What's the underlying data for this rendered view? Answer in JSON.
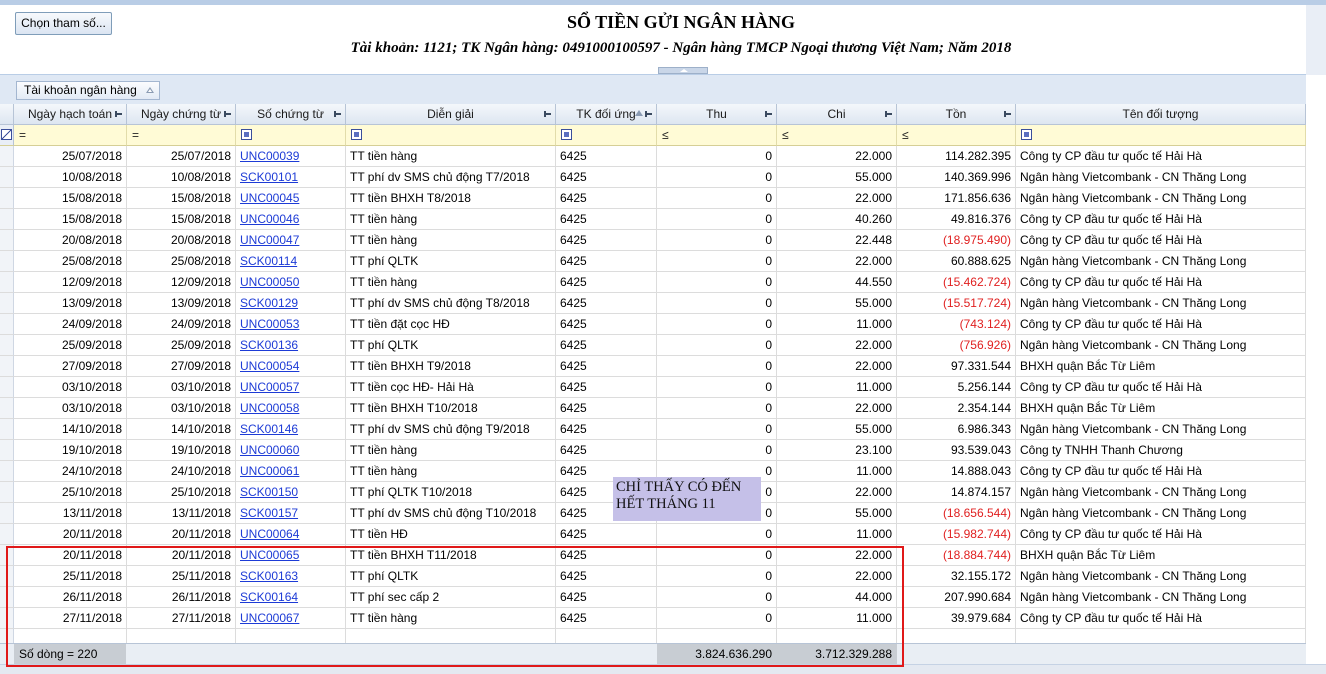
{
  "toolbar": {
    "param_button": "Chọn tham số..."
  },
  "report": {
    "title": "SỔ TIỀN GỬI NGÂN HÀNG",
    "subtitle": "Tài khoản: 1121; TK Ngân hàng: 0491000100597 - Ngân hàng TMCP Ngoại thương Việt Nam; Năm 2018"
  },
  "group_panel": {
    "chip_label": "Tài khoản ngân hàng"
  },
  "columns": [
    {
      "key": "ngay_ht",
      "label": "Ngày hạch toán",
      "filter": "="
    },
    {
      "key": "ngay_ct",
      "label": "Ngày chứng từ",
      "filter": "="
    },
    {
      "key": "so_ct",
      "label": "Số chứng từ",
      "filter": "box"
    },
    {
      "key": "dien_giai",
      "label": "Diễn giải",
      "filter": "box"
    },
    {
      "key": "tk_du",
      "label": "TK đối ứng",
      "filter": "box"
    },
    {
      "key": "thu",
      "label": "Thu",
      "filter": "≤"
    },
    {
      "key": "chi",
      "label": "Chi",
      "filter": "≤"
    },
    {
      "key": "ton",
      "label": "Tồn",
      "filter": "≤"
    },
    {
      "key": "doi_tuong",
      "label": "Tên đối tượng",
      "filter": "box"
    }
  ],
  "rows": [
    [
      "25/07/2018",
      "25/07/2018",
      "UNC00039",
      "TT tiền hàng",
      "6425",
      "0",
      "22.000",
      "114.282.395",
      "Công ty CP đầu tư quốc tế Hải Hà"
    ],
    [
      "10/08/2018",
      "10/08/2018",
      "SCK00101",
      "TT phí dv SMS chủ động T7/2018",
      "6425",
      "0",
      "55.000",
      "140.369.996",
      "Ngân hàng Vietcombank - CN Thăng Long"
    ],
    [
      "15/08/2018",
      "15/08/2018",
      "UNC00045",
      "TT tiền BHXH T8/2018",
      "6425",
      "0",
      "22.000",
      "171.856.636",
      "Ngân hàng Vietcombank - CN Thăng Long"
    ],
    [
      "15/08/2018",
      "15/08/2018",
      "UNC00046",
      "TT tiền hàng",
      "6425",
      "0",
      "40.260",
      "49.816.376",
      "Công ty CP đầu tư quốc tế Hải Hà"
    ],
    [
      "20/08/2018",
      "20/08/2018",
      "UNC00047",
      "TT tiền hàng",
      "6425",
      "0",
      "22.448",
      "(18.975.490)",
      "Công ty CP đầu tư quốc tế Hải Hà"
    ],
    [
      "25/08/2018",
      "25/08/2018",
      "SCK00114",
      "TT phí QLTK",
      "6425",
      "0",
      "22.000",
      "60.888.625",
      "Ngân hàng Vietcombank - CN Thăng Long"
    ],
    [
      "12/09/2018",
      "12/09/2018",
      "UNC00050",
      "TT tiền hàng",
      "6425",
      "0",
      "44.550",
      "(15.462.724)",
      "Công ty CP đầu tư quốc tế Hải Hà"
    ],
    [
      "13/09/2018",
      "13/09/2018",
      "SCK00129",
      "TT phí dv SMS chủ động T8/2018",
      "6425",
      "0",
      "55.000",
      "(15.517.724)",
      "Ngân hàng Vietcombank - CN Thăng Long"
    ],
    [
      "24/09/2018",
      "24/09/2018",
      "UNC00053",
      "TT tiền đặt cọc HĐ",
      "6425",
      "0",
      "11.000",
      "(743.124)",
      "Công ty CP đầu tư quốc tế Hải Hà"
    ],
    [
      "25/09/2018",
      "25/09/2018",
      "SCK00136",
      "TT phí QLTK",
      "6425",
      "0",
      "22.000",
      "(756.926)",
      "Ngân hàng Vietcombank - CN Thăng Long"
    ],
    [
      "27/09/2018",
      "27/09/2018",
      "UNC00054",
      "TT tiền BHXH T9/2018",
      "6425",
      "0",
      "22.000",
      "97.331.544",
      "BHXH quận Bắc Từ Liêm"
    ],
    [
      "03/10/2018",
      "03/10/2018",
      "UNC00057",
      "TT tiền cọc HĐ- Hải Hà",
      "6425",
      "0",
      "11.000",
      "5.256.144",
      "Công ty CP đầu tư quốc tế Hải Hà"
    ],
    [
      "03/10/2018",
      "03/10/2018",
      "UNC00058",
      "TT tiền BHXH T10/2018",
      "6425",
      "0",
      "22.000",
      "2.354.144",
      "BHXH quận Bắc Từ Liêm"
    ],
    [
      "14/10/2018",
      "14/10/2018",
      "SCK00146",
      "TT phí dv SMS chủ động T9/2018",
      "6425",
      "0",
      "55.000",
      "6.986.343",
      "Ngân hàng Vietcombank - CN Thăng Long"
    ],
    [
      "19/10/2018",
      "19/10/2018",
      "UNC00060",
      "TT tiền hàng",
      "6425",
      "0",
      "23.100",
      "93.539.043",
      "Công ty TNHH Thanh Chương"
    ],
    [
      "24/10/2018",
      "24/10/2018",
      "UNC00061",
      "TT tiền hàng",
      "6425",
      "0",
      "11.000",
      "14.888.043",
      "Công ty CP đầu tư quốc tế Hải Hà"
    ],
    [
      "25/10/2018",
      "25/10/2018",
      "SCK00150",
      "TT phí QLTK T10/2018",
      "6425",
      "0",
      "22.000",
      "14.874.157",
      "Ngân hàng Vietcombank - CN Thăng Long"
    ],
    [
      "13/11/2018",
      "13/11/2018",
      "SCK00157",
      "TT phí dv SMS chủ động T10/2018",
      "6425",
      "0",
      "55.000",
      "(18.656.544)",
      "Ngân hàng Vietcombank - CN Thăng Long"
    ],
    [
      "20/11/2018",
      "20/11/2018",
      "UNC00064",
      "TT tiền HĐ",
      "6425",
      "0",
      "11.000",
      "(15.982.744)",
      "Công ty CP đầu tư quốc tế Hải Hà"
    ],
    [
      "20/11/2018",
      "20/11/2018",
      "UNC00065",
      "TT tiền BHXH T11/2018",
      "6425",
      "0",
      "22.000",
      "(18.884.744)",
      "BHXH quận Bắc Từ Liêm"
    ],
    [
      "25/11/2018",
      "25/11/2018",
      "SCK00163",
      "TT phí QLTK",
      "6425",
      "0",
      "22.000",
      "32.155.172",
      "Ngân hàng Vietcombank - CN Thăng Long"
    ],
    [
      "26/11/2018",
      "26/11/2018",
      "SCK00164",
      "TT phí sec cấp 2",
      "6425",
      "0",
      "44.000",
      "207.990.684",
      "Ngân hàng Vietcombank - CN Thăng Long"
    ],
    [
      "27/11/2018",
      "27/11/2018",
      "UNC00067",
      "TT tiền hàng",
      "6425",
      "0",
      "11.000",
      "39.979.684",
      "Công ty CP đầu tư quốc tế Hải Hà"
    ]
  ],
  "footer": {
    "row_count": "Số dòng = 220",
    "total_thu": "3.824.636.290",
    "total_chi": "3.712.329.288"
  },
  "note": "CHỈ THẤY CÓ ĐẾN HẾT THÁNG 11",
  "colors": {
    "negative": "#e02020",
    "link": "#1d3bd6",
    "highlight_border": "#e01919",
    "note_bg": "#c5c0e8",
    "filter_row_bg": "#fffbd6"
  }
}
